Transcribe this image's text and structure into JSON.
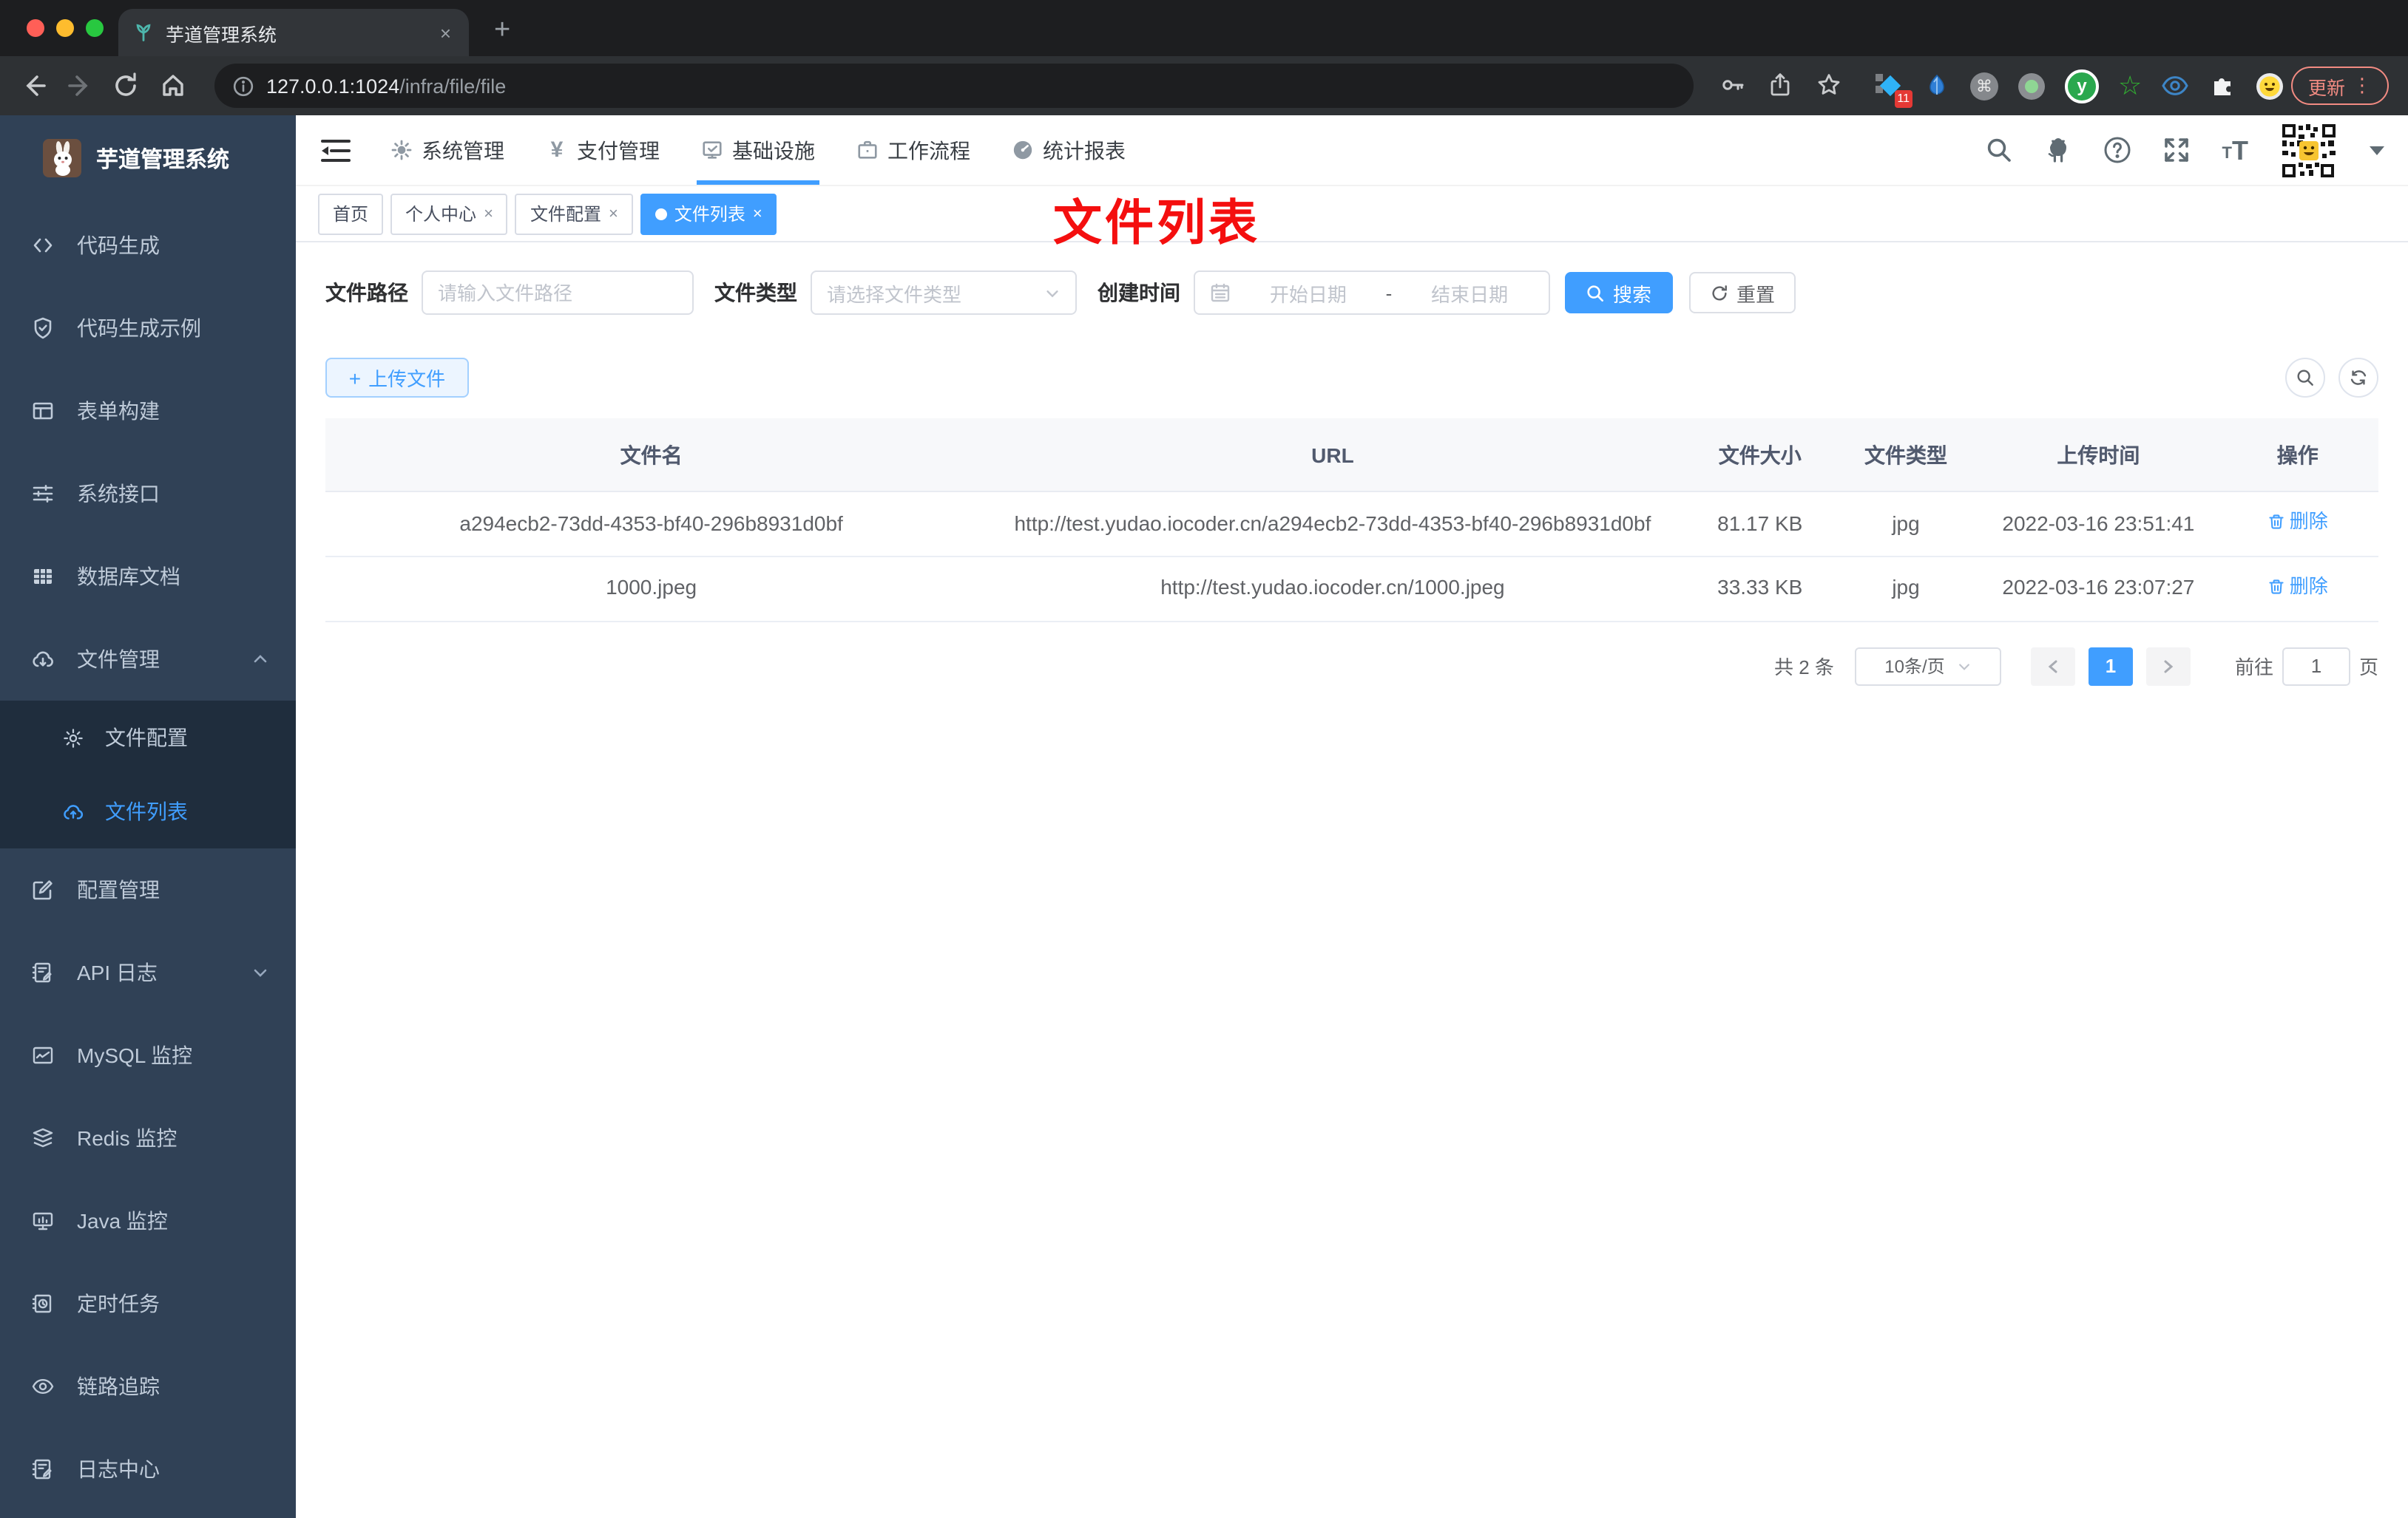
{
  "browser": {
    "tab_title": "芋道管理系统",
    "url_host": "127.0.0.1:1024",
    "url_path": "/infra/file/file",
    "new_tab": "+",
    "tab_close": "×",
    "ext_badge": "11",
    "ext_cmd": "⌘",
    "ext_y": "y",
    "ext_star": "☆",
    "update_label": "更新",
    "kebab": "⋮"
  },
  "app": {
    "title": "芋道管理系统"
  },
  "sidebar": {
    "items": [
      {
        "label": "代码生成"
      },
      {
        "label": "代码生成示例"
      },
      {
        "label": "表单构建"
      },
      {
        "label": "系统接口"
      },
      {
        "label": "数据库文档"
      },
      {
        "label": "文件管理"
      },
      {
        "label": "配置管理"
      },
      {
        "label": "API 日志"
      },
      {
        "label": "MySQL 监控"
      },
      {
        "label": "Redis 监控"
      },
      {
        "label": "Java 监控"
      },
      {
        "label": "定时任务"
      },
      {
        "label": "链路追踪"
      },
      {
        "label": "日志中心"
      }
    ],
    "submenu": [
      {
        "label": "文件配置"
      },
      {
        "label": "文件列表"
      }
    ]
  },
  "topnav": {
    "items": [
      {
        "label": "系统管理"
      },
      {
        "label": "支付管理"
      },
      {
        "label": "基础设施"
      },
      {
        "label": "工作流程"
      },
      {
        "label": "统计报表"
      }
    ],
    "yen": "¥"
  },
  "tabs": {
    "items": [
      {
        "label": "首页"
      },
      {
        "label": "个人中心"
      },
      {
        "label": "文件配置"
      },
      {
        "label": "文件列表"
      }
    ],
    "close": "×"
  },
  "annotation": {
    "text": "文件列表"
  },
  "filter": {
    "path_label": "文件路径",
    "path_placeholder": "请输入文件路径",
    "type_label": "文件类型",
    "type_placeholder": "请选择文件类型",
    "date_label": "创建时间",
    "date_start": "开始日期",
    "date_sep": "-",
    "date_end": "结束日期",
    "search_label": "搜索",
    "reset_label": "重置"
  },
  "toolbar": {
    "upload_label": "上传文件",
    "plus": "+"
  },
  "table": {
    "headers": [
      "文件名",
      "URL",
      "文件大小",
      "文件类型",
      "上传时间",
      "操作"
    ],
    "rows": [
      {
        "name": "a294ecb2-73dd-4353-bf40-296b8931d0bf",
        "url": "http://test.yudao.iocoder.cn/a294ecb2-73dd-4353-bf40-296b8931d0bf",
        "size": "81.17 KB",
        "type": "jpg",
        "time": "2022-03-16 23:51:41",
        "action": "删除"
      },
      {
        "name": "1000.jpeg",
        "url": "http://test.yudao.iocoder.cn/1000.jpeg",
        "size": "33.33 KB",
        "type": "jpg",
        "time": "2022-03-16 23:07:27",
        "action": "删除"
      }
    ]
  },
  "pagination": {
    "total": "共 2 条",
    "page_size": "10条/页",
    "current": "1",
    "goto_label": "前往",
    "goto_value": "1",
    "page_unit": "页"
  },
  "colors": {
    "accent": "#409eff",
    "sidebar_bg": "#304156",
    "submenu_bg": "#1f2d3d",
    "annotation_red": "#f40f0f",
    "update_chip": "#f28b82"
  }
}
